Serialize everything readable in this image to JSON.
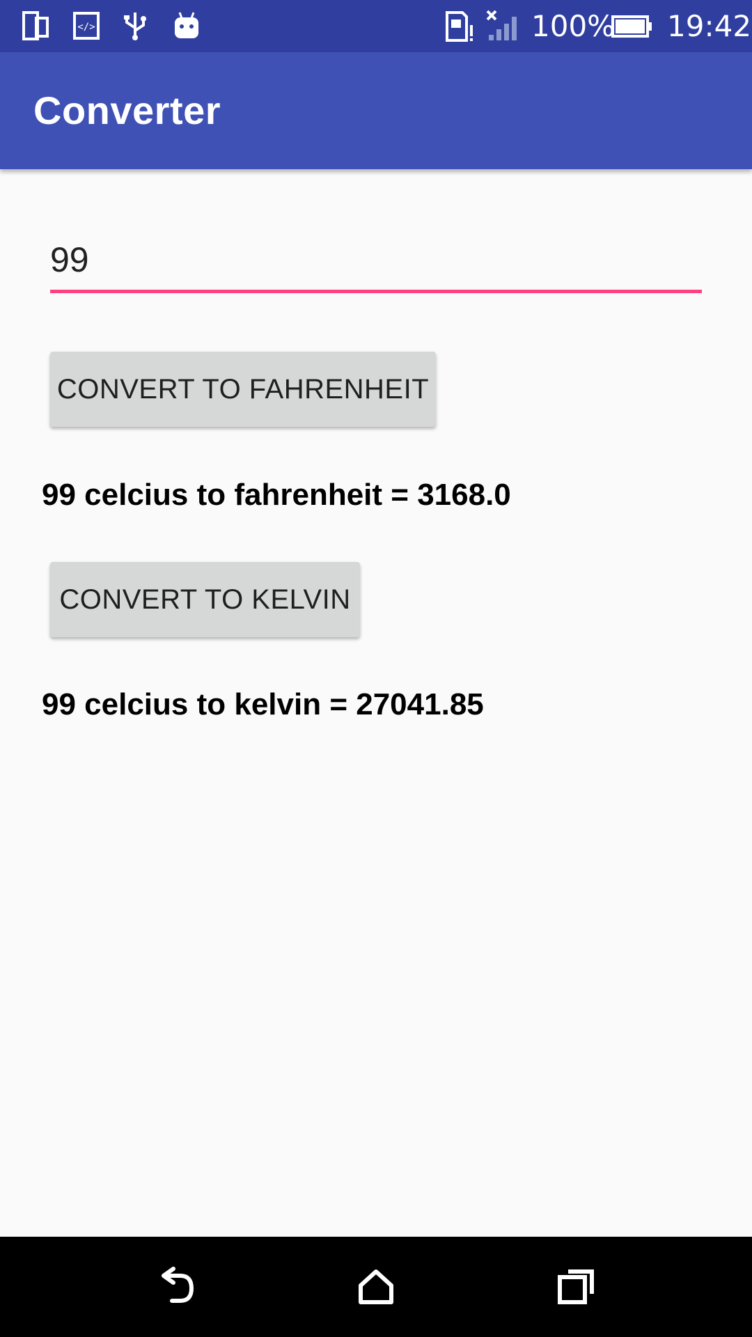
{
  "status_bar": {
    "icons": [
      "device-icon",
      "code-icon",
      "usb-icon",
      "android-icon",
      "sim-alert-icon",
      "signal-icon",
      "battery-icon"
    ],
    "battery_text": "100%",
    "time": "19:42"
  },
  "app_bar": {
    "title": "Converter",
    "color": "#3f51b5",
    "status_color": "#303f9f"
  },
  "input": {
    "value": "99",
    "underline_color": "#ff4081"
  },
  "buttons": {
    "fahrenheit_label": "CONVERT TO FAHRENHEIT",
    "kelvin_label": "CONVERT TO KELVIN"
  },
  "results": {
    "fahrenheit": "99 celcius to fahrenheit = 3168.0",
    "kelvin": "99 celcius to kelvin = 27041.85"
  },
  "nav_bar": {
    "icons": [
      "back-icon",
      "home-icon",
      "recents-icon"
    ]
  }
}
